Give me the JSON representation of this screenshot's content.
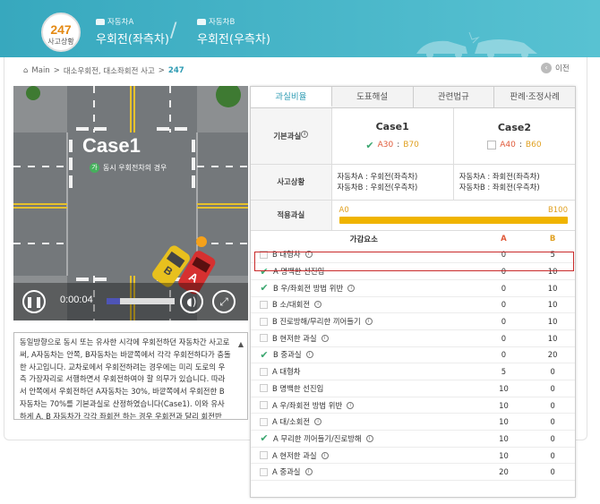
{
  "header": {
    "badge_number": "247",
    "badge_label": "사고상황",
    "vehicle_a_label": "자동차A",
    "vehicle_a_action": "우회전(좌측차)",
    "vehicle_b_label": "자동차B",
    "vehicle_b_action": "우회전(우측차)",
    "separator": "/"
  },
  "breadcrumb": {
    "home": "Main",
    "sep1": ">",
    "level1": "대소우회전, 대소좌회전 사고",
    "sep2": ">",
    "current": "247"
  },
  "prev_label": "이전",
  "video": {
    "case_title": "Case1",
    "case_sub_badge": "가",
    "case_sub_text": "동시 우회전차의 경우",
    "time": "0:00:04",
    "progress": 0.2,
    "car_a": "A",
    "car_b": "B"
  },
  "description": "동일방향으로 동시 또는 유사한 시각에 우회전하던 자동차간 사고로써, A자동차는 안쪽, B자동차는 바깥쪽에서 각각 우회전하다가 충돌한 사고입니다. 교차로에서 우회전하려는 경우에는 미리 도로의 우측 가장자리로 서행하면서 우회전하여야 할 의무가 있습니다. 따라서 안쪽에서 우회전하던 A자동차는 30%, 바깥쪽에서 우회전한 B자동차는 70%를 기본과실로 산정하였습니다(Case1). 이와 유사하게 A, B 자동차가 각각 좌회전 하는 경우 우회전과 달리 회전반",
  "tabs": [
    "과실비율",
    "도표해설",
    "관련법규",
    "판례·조정사례"
  ],
  "info": {
    "base_fault_label": "기본과실",
    "case1": {
      "title": "Case1",
      "a": "A30",
      "sep": ":",
      "b": "B70",
      "checked": true
    },
    "case2": {
      "title": "Case2",
      "a": "A40",
      "sep": ":",
      "b": "B60",
      "checked": false
    },
    "situation_label": "사고상황",
    "case1_situation": [
      "자동차A : 우회전(좌측차)",
      "자동차B : 우회전(우측차)"
    ],
    "case2_situation": [
      "자동차A : 좌회전(좌측차)",
      "자동차B : 좌회전(우측차)"
    ],
    "applied_label": "적용과실",
    "applied_a": "A0",
    "applied_b": "B100"
  },
  "factors": {
    "header_name": "가감요소",
    "header_a": "A",
    "header_b": "B",
    "rows": [
      {
        "name": "B 대형차",
        "a": "0",
        "b": "5",
        "checked": false,
        "info": true
      },
      {
        "name": "A 명백한 선진입",
        "a": "0",
        "b": "10",
        "checked": true,
        "info": false
      },
      {
        "name": "B 우/좌회전 방법 위반",
        "a": "0",
        "b": "10",
        "checked": true,
        "info": true
      },
      {
        "name": "B 소/대회전",
        "a": "0",
        "b": "10",
        "checked": false,
        "info": true
      },
      {
        "name": "B 진로방해/무리한 끼어들기",
        "a": "0",
        "b": "10",
        "checked": false,
        "info": true
      },
      {
        "name": "B 현저한 과실",
        "a": "0",
        "b": "10",
        "checked": false,
        "info": true
      },
      {
        "name": "B 중과실",
        "a": "0",
        "b": "20",
        "checked": true,
        "info": true
      },
      {
        "name": "A 대형차",
        "a": "5",
        "b": "0",
        "checked": false,
        "info": false
      },
      {
        "name": "B 명백한 선진입",
        "a": "10",
        "b": "0",
        "checked": false,
        "info": false
      },
      {
        "name": "A 우/좌회전 방법 위반",
        "a": "10",
        "b": "0",
        "checked": false,
        "info": true
      },
      {
        "name": "A 대/소회전",
        "a": "10",
        "b": "0",
        "checked": false,
        "info": true
      },
      {
        "name": "A 무리한 끼어들기/진로방해",
        "a": "10",
        "b": "0",
        "checked": true,
        "info": true
      },
      {
        "name": "A 현저한 과실",
        "a": "10",
        "b": "0",
        "checked": false,
        "info": true
      },
      {
        "name": "A 중과실",
        "a": "20",
        "b": "0",
        "checked": false,
        "info": true
      }
    ]
  },
  "colors": {
    "accent": "#2e9bb3",
    "header": "#41aec2",
    "fault_a": "#e05a3a",
    "fault_b": "#e0a020",
    "highlight": "#c92a2a"
  }
}
